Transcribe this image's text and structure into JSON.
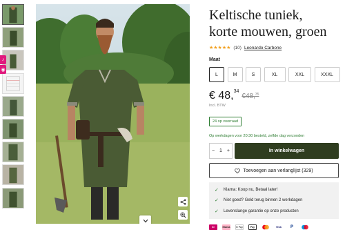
{
  "product": {
    "title_line1": "Keltische tuniek,",
    "title_line2": "korte mouwen, groen",
    "stars": "★★★★★",
    "review_count": "(10)",
    "author": "Leonardo Carbone"
  },
  "sizes": {
    "label": "Maat",
    "options": [
      "L",
      "M",
      "S",
      "XL",
      "XXL",
      "XXXL"
    ],
    "selected": "L"
  },
  "price": {
    "current_main": "€ 48,",
    "current_cents": "34",
    "old_main": "€48,",
    "old_cents": "35",
    "vat_note": "Incl. BTW"
  },
  "stock": {
    "badge": "24 op voorraad",
    "shipping_note": "Op werkdagen voor 20:30 besteld, zelfde dag verzonden"
  },
  "cart": {
    "qty_minus": "−",
    "qty_value": "1",
    "qty_plus": "+",
    "button_label": "In winkelwagen"
  },
  "wishlist": {
    "label": "Toevoegen aan verlanglijst (329)"
  },
  "usps": [
    "Klarna: Koop nu, Betaal later!",
    "Niet goed? Geld terug binnen 2 werkdagen",
    "Levenslange garantie op onze producten"
  ],
  "payment_methods": [
    {
      "name": "ideal",
      "color": "#cc0066",
      "text": "iD"
    },
    {
      "name": "klarna",
      "color": "#ffb3c7",
      "text": "Klarna"
    },
    {
      "name": "gpay",
      "color": "#ffffff",
      "text": "G Pay"
    },
    {
      "name": "applepay",
      "color": "#ffffff",
      "text": "Pay"
    },
    {
      "name": "mastercard",
      "color": "#eb001b",
      "text": ""
    },
    {
      "name": "visa",
      "color": "#1a1f71",
      "text": "VISA"
    },
    {
      "name": "paypal",
      "color": "#ffffff",
      "text": "P"
    },
    {
      "name": "maestro",
      "color": "#0099df",
      "text": ""
    }
  ],
  "side_badges": [
    "♪",
    "◉"
  ],
  "colors": {
    "brand_dark": "#2f3d1f",
    "stock_green": "#2e7d32",
    "star": "#f2a01e"
  },
  "icons": {
    "share": "share-icon",
    "zoom": "zoom-in-icon",
    "chevron": "chevron-down-icon",
    "heart": "heart-icon",
    "check": "check-icon"
  }
}
